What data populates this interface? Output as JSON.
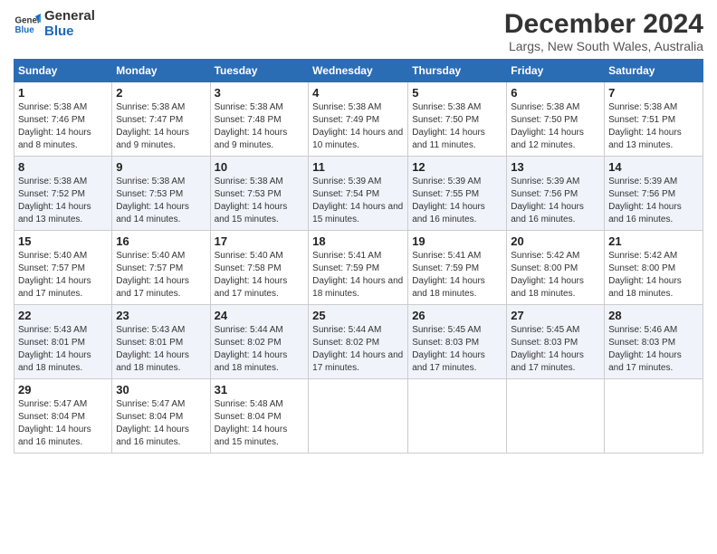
{
  "logo": {
    "line1": "General",
    "line2": "Blue"
  },
  "title": "December 2024",
  "location": "Largs, New South Wales, Australia",
  "days_of_week": [
    "Sunday",
    "Monday",
    "Tuesday",
    "Wednesday",
    "Thursday",
    "Friday",
    "Saturday"
  ],
  "weeks": [
    [
      {
        "day": "1",
        "sunrise": "5:38 AM",
        "sunset": "7:46 PM",
        "daylight": "14 hours and 8 minutes."
      },
      {
        "day": "2",
        "sunrise": "5:38 AM",
        "sunset": "7:47 PM",
        "daylight": "14 hours and 9 minutes."
      },
      {
        "day": "3",
        "sunrise": "5:38 AM",
        "sunset": "7:48 PM",
        "daylight": "14 hours and 9 minutes."
      },
      {
        "day": "4",
        "sunrise": "5:38 AM",
        "sunset": "7:49 PM",
        "daylight": "14 hours and 10 minutes."
      },
      {
        "day": "5",
        "sunrise": "5:38 AM",
        "sunset": "7:50 PM",
        "daylight": "14 hours and 11 minutes."
      },
      {
        "day": "6",
        "sunrise": "5:38 AM",
        "sunset": "7:50 PM",
        "daylight": "14 hours and 12 minutes."
      },
      {
        "day": "7",
        "sunrise": "5:38 AM",
        "sunset": "7:51 PM",
        "daylight": "14 hours and 13 minutes."
      }
    ],
    [
      {
        "day": "8",
        "sunrise": "5:38 AM",
        "sunset": "7:52 PM",
        "daylight": "14 hours and 13 minutes."
      },
      {
        "day": "9",
        "sunrise": "5:38 AM",
        "sunset": "7:53 PM",
        "daylight": "14 hours and 14 minutes."
      },
      {
        "day": "10",
        "sunrise": "5:38 AM",
        "sunset": "7:53 PM",
        "daylight": "14 hours and 15 minutes."
      },
      {
        "day": "11",
        "sunrise": "5:39 AM",
        "sunset": "7:54 PM",
        "daylight": "14 hours and 15 minutes."
      },
      {
        "day": "12",
        "sunrise": "5:39 AM",
        "sunset": "7:55 PM",
        "daylight": "14 hours and 16 minutes."
      },
      {
        "day": "13",
        "sunrise": "5:39 AM",
        "sunset": "7:56 PM",
        "daylight": "14 hours and 16 minutes."
      },
      {
        "day": "14",
        "sunrise": "5:39 AM",
        "sunset": "7:56 PM",
        "daylight": "14 hours and 16 minutes."
      }
    ],
    [
      {
        "day": "15",
        "sunrise": "5:40 AM",
        "sunset": "7:57 PM",
        "daylight": "14 hours and 17 minutes."
      },
      {
        "day": "16",
        "sunrise": "5:40 AM",
        "sunset": "7:57 PM",
        "daylight": "14 hours and 17 minutes."
      },
      {
        "day": "17",
        "sunrise": "5:40 AM",
        "sunset": "7:58 PM",
        "daylight": "14 hours and 17 minutes."
      },
      {
        "day": "18",
        "sunrise": "5:41 AM",
        "sunset": "7:59 PM",
        "daylight": "14 hours and 18 minutes."
      },
      {
        "day": "19",
        "sunrise": "5:41 AM",
        "sunset": "7:59 PM",
        "daylight": "14 hours and 18 minutes."
      },
      {
        "day": "20",
        "sunrise": "5:42 AM",
        "sunset": "8:00 PM",
        "daylight": "14 hours and 18 minutes."
      },
      {
        "day": "21",
        "sunrise": "5:42 AM",
        "sunset": "8:00 PM",
        "daylight": "14 hours and 18 minutes."
      }
    ],
    [
      {
        "day": "22",
        "sunrise": "5:43 AM",
        "sunset": "8:01 PM",
        "daylight": "14 hours and 18 minutes."
      },
      {
        "day": "23",
        "sunrise": "5:43 AM",
        "sunset": "8:01 PM",
        "daylight": "14 hours and 18 minutes."
      },
      {
        "day": "24",
        "sunrise": "5:44 AM",
        "sunset": "8:02 PM",
        "daylight": "14 hours and 18 minutes."
      },
      {
        "day": "25",
        "sunrise": "5:44 AM",
        "sunset": "8:02 PM",
        "daylight": "14 hours and 17 minutes."
      },
      {
        "day": "26",
        "sunrise": "5:45 AM",
        "sunset": "8:03 PM",
        "daylight": "14 hours and 17 minutes."
      },
      {
        "day": "27",
        "sunrise": "5:45 AM",
        "sunset": "8:03 PM",
        "daylight": "14 hours and 17 minutes."
      },
      {
        "day": "28",
        "sunrise": "5:46 AM",
        "sunset": "8:03 PM",
        "daylight": "14 hours and 17 minutes."
      }
    ],
    [
      {
        "day": "29",
        "sunrise": "5:47 AM",
        "sunset": "8:04 PM",
        "daylight": "14 hours and 16 minutes."
      },
      {
        "day": "30",
        "sunrise": "5:47 AM",
        "sunset": "8:04 PM",
        "daylight": "14 hours and 16 minutes."
      },
      {
        "day": "31",
        "sunrise": "5:48 AM",
        "sunset": "8:04 PM",
        "daylight": "14 hours and 15 minutes."
      },
      null,
      null,
      null,
      null
    ]
  ]
}
